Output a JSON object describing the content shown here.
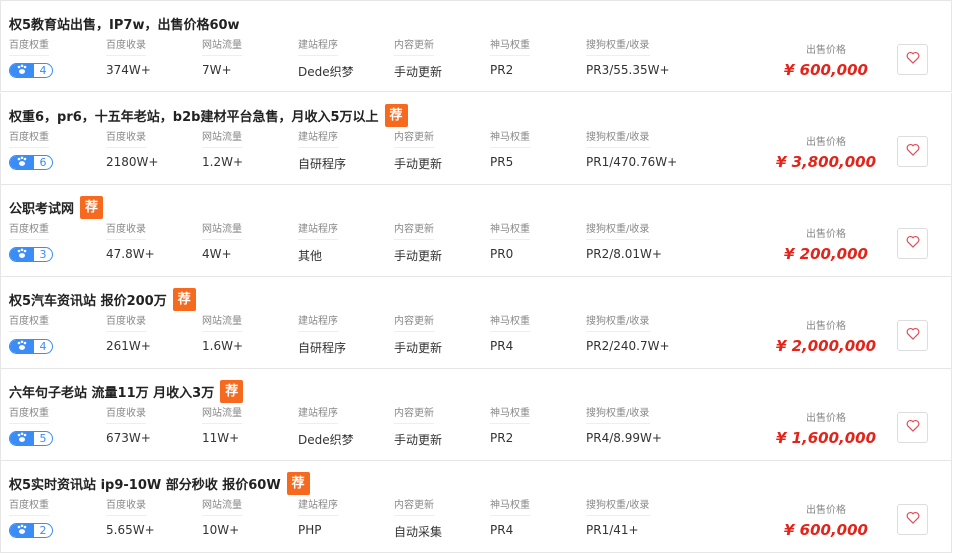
{
  "labels": {
    "baidu_weight": "百度权重",
    "baidu_index": "百度收录",
    "traffic": "网站流量",
    "program": "建站程序",
    "update": "内容更新",
    "shenma": "神马权重",
    "sogou": "搜狗权重/收录",
    "price": "出售价格",
    "recommend": "荐"
  },
  "icons": {
    "badge": "paw-icon",
    "favorite": "heart-outline-icon"
  },
  "colors": {
    "price": "#e3241b",
    "badge": "#3b8cf5",
    "recommend": "#f56a1f",
    "heart": "#e04b57"
  },
  "listings": [
    {
      "title": "权5教育站出售，IP7w，出售价格60w",
      "recommended": false,
      "baidu_weight": "4",
      "baidu_index": "374W+",
      "traffic": "7W+",
      "program": "Dede织梦",
      "update": "手动更新",
      "shenma": "PR2",
      "sogou": "PR3/55.35W+",
      "price": "¥ 600,000"
    },
    {
      "title": "权重6，pr6，十五年老站，b2b建材平台急售，月收入5万以上",
      "recommended": true,
      "baidu_weight": "6",
      "baidu_index": "2180W+",
      "traffic": "1.2W+",
      "program": "自研程序",
      "update": "手动更新",
      "shenma": "PR5",
      "sogou": "PR1/470.76W+",
      "price": "¥ 3,800,000"
    },
    {
      "title": "公职考试网",
      "recommended": true,
      "baidu_weight": "3",
      "baidu_index": "47.8W+",
      "traffic": "4W+",
      "program": "其他",
      "update": "手动更新",
      "shenma": "PR0",
      "sogou": "PR2/8.01W+",
      "price": "¥ 200,000"
    },
    {
      "title": "权5汽车资讯站 报价200万",
      "recommended": true,
      "baidu_weight": "4",
      "baidu_index": "261W+",
      "traffic": "1.6W+",
      "program": "自研程序",
      "update": "手动更新",
      "shenma": "PR4",
      "sogou": "PR2/240.7W+",
      "price": "¥ 2,000,000"
    },
    {
      "title": "六年句子老站 流量11万 月收入3万",
      "recommended": true,
      "baidu_weight": "5",
      "baidu_index": "673W+",
      "traffic": "11W+",
      "program": "Dede织梦",
      "update": "手动更新",
      "shenma": "PR2",
      "sogou": "PR4/8.99W+",
      "price": "¥ 1,600,000"
    },
    {
      "title": "权5实时资讯站 ip9-10W 部分秒收 报价60W",
      "recommended": true,
      "baidu_weight": "2",
      "baidu_index": "5.65W+",
      "traffic": "10W+",
      "program": "PHP",
      "update": "自动采集",
      "shenma": "PR4",
      "sogou": "PR1/41+",
      "price": "¥ 600,000"
    }
  ]
}
